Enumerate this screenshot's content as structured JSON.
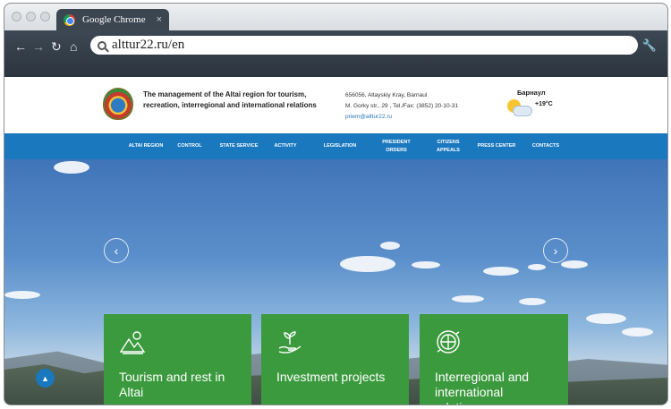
{
  "browser": {
    "tab_title": "Google Chrome",
    "tab_close": "×",
    "url": "alttur22.ru/en",
    "back_glyph": "←",
    "forward_glyph": "→",
    "reload_glyph": "↻",
    "home_glyph": "⌂",
    "wrench_glyph": "🔧"
  },
  "header": {
    "org_name": "The management of the Altai region for tourism, recreation, interregional and international relations",
    "address_line1": "656056, Altayskiy Kray, Barnaul",
    "address_line2": "M. Gorky str., 29 , Tel./Fax: (3852) 20-10-31",
    "email": "priem@alttur22.ru",
    "weather_city": "Барнаул",
    "weather_temp": "+19°C"
  },
  "menu": {
    "items": [
      {
        "label": "ALTAI REGION"
      },
      {
        "label": "CONTROL"
      },
      {
        "label": "STATE SERVICE"
      },
      {
        "label": "ACTIVITY"
      },
      {
        "label": "LEGISLATION"
      },
      {
        "label": "PRESIDENT ORDERS"
      },
      {
        "label": "CITIZENS APPEALS"
      },
      {
        "label": "PRESS CENTER"
      },
      {
        "label": "CONTACTS"
      }
    ]
  },
  "hero": {
    "prev_glyph": "‹",
    "next_glyph": "›",
    "scroll_top_glyph": "▲"
  },
  "cards": [
    {
      "label": "Tourism and rest in Altai",
      "icon": "mountains-sun-icon"
    },
    {
      "label": "Investment projects",
      "icon": "hand-sprout-icon"
    },
    {
      "label": "Interregional and international relations",
      "icon": "globe-arrows-icon"
    }
  ],
  "colors": {
    "menu_blue": "#1a78bf",
    "card_green": "#3c9a3e",
    "chrome_dark": "#2f3a45"
  }
}
